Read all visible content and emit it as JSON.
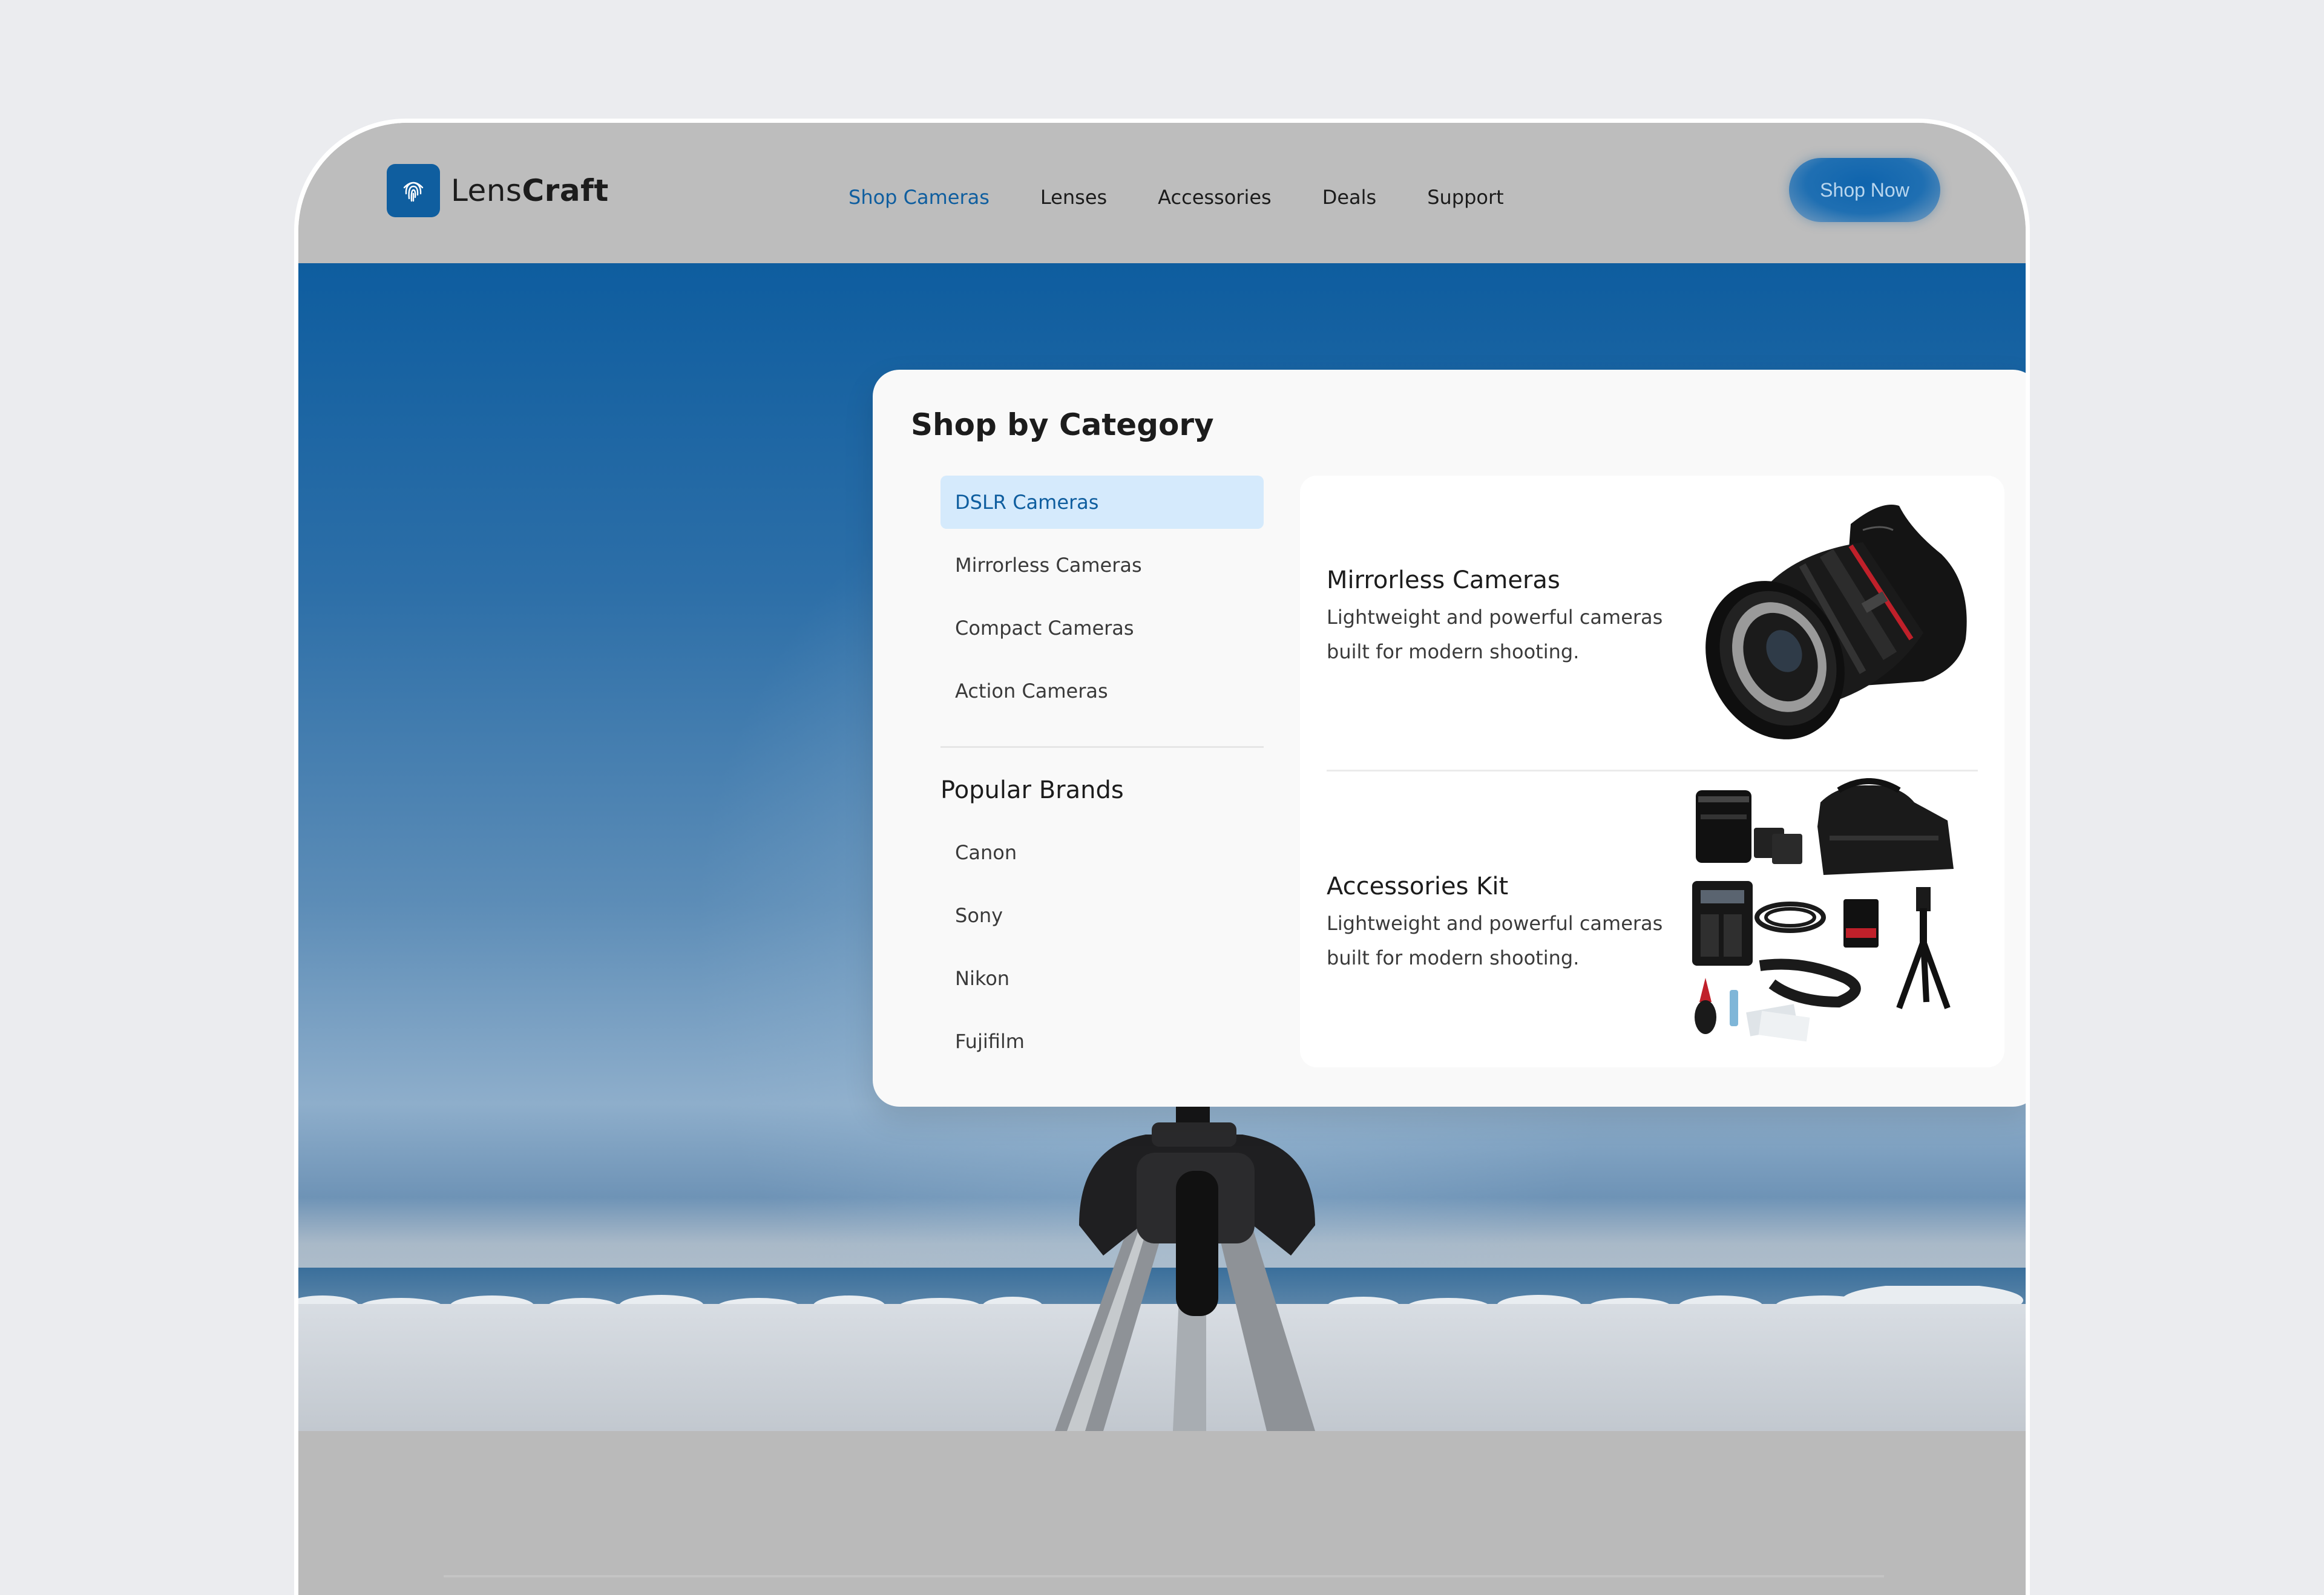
{
  "brand": {
    "name_light": "Lens",
    "name_bold": "Craft",
    "color": "#0f5e9f"
  },
  "nav": {
    "links": [
      {
        "label": "Shop Cameras",
        "active": true
      },
      {
        "label": "Lenses",
        "active": false
      },
      {
        "label": "Accessories",
        "active": false
      },
      {
        "label": "Deals",
        "active": false
      },
      {
        "label": "Support",
        "active": false
      }
    ],
    "cta_label": "Shop Now"
  },
  "mega_menu": {
    "title": "Shop by Category",
    "categories": [
      {
        "label": "DSLR Cameras",
        "active": true
      },
      {
        "label": "Mirrorless Cameras",
        "active": false
      },
      {
        "label": "Compact Cameras",
        "active": false
      },
      {
        "label": "Action Cameras",
        "active": false
      }
    ],
    "brands_title": "Popular Brands",
    "brands": [
      "Canon",
      "Sony",
      "Nikon",
      "Fujifilm"
    ],
    "features": [
      {
        "title": "Mirrorless Cameras",
        "description": "Lightweight and powerful cameras built for modern shooting.",
        "image": "camera-lens-image"
      },
      {
        "title": "Accessories Kit",
        "description": "Lightweight and powerful cameras built for modern shooting.",
        "image": "accessories-kit-image"
      }
    ]
  },
  "hero": {
    "image": "camera-on-tripod-beach-image"
  }
}
